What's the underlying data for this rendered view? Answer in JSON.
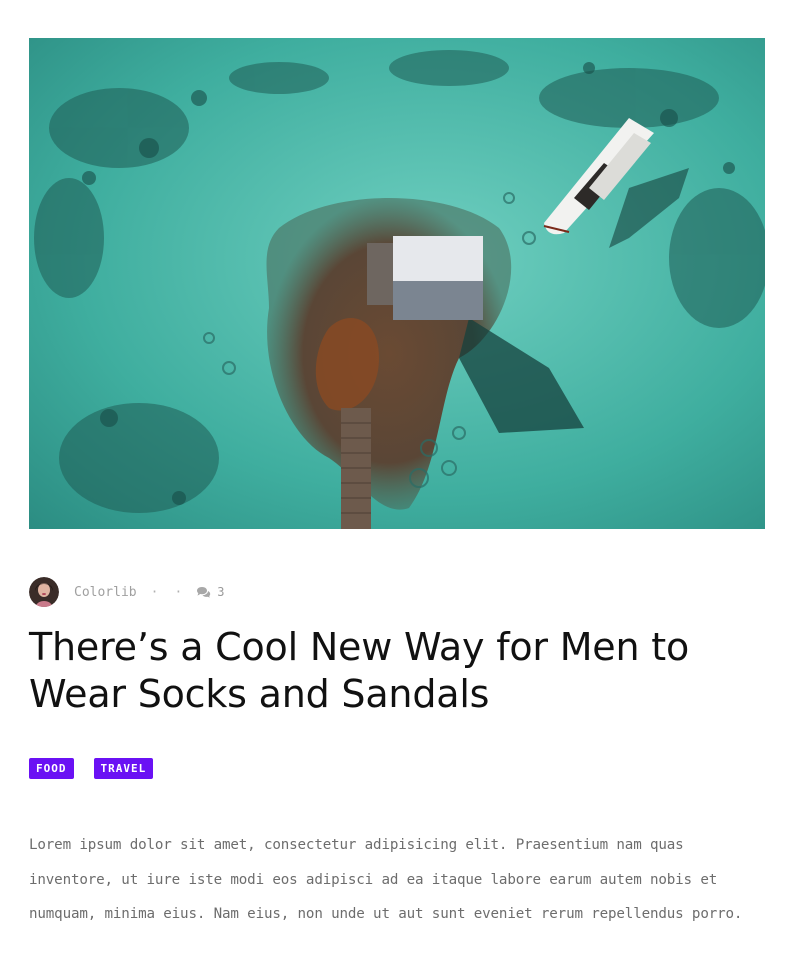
{
  "post": {
    "author": "Colorlib",
    "separator_1": "·",
    "separator_2": "·",
    "comment_count": "3",
    "title": "There’s a Cool New Way for Men to Wear Socks and Sandals",
    "tags": [
      {
        "label": "FOOD"
      },
      {
        "label": "TRAVEL"
      }
    ],
    "excerpt": "Lorem ipsum dolor sit amet, consectetur adipisicing elit. Praesentium nam quas inventore, ut iure iste modi eos adipisci ad ea itaque labore earum autem nobis et numquam, minima eius. Nam eius, non unde ut aut sunt eveniet rerum repellendus porro."
  },
  "icons": {
    "comment": "comment-icon"
  },
  "colors": {
    "tag_background": "#6a11f4",
    "title_text": "#111111",
    "body_text": "#6d6d6d",
    "meta_text": "#9a9a9a"
  }
}
